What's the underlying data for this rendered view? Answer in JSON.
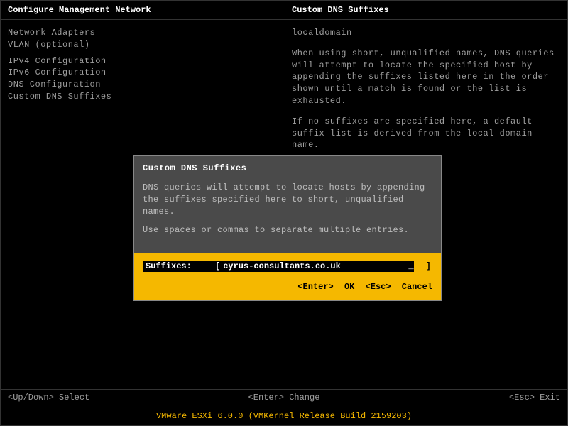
{
  "header": {
    "left": "Configure Management Network",
    "right": "Custom DNS Suffixes"
  },
  "menu": {
    "items": [
      "Network Adapters",
      "VLAN (optional)",
      "",
      "IPv4 Configuration",
      "IPv6 Configuration",
      "DNS Configuration",
      "Custom DNS Suffixes"
    ]
  },
  "info": {
    "domain": "localdomain",
    "p1": "When using short, unqualified names, DNS queries will attempt to locate the specified host by appending the suffixes listed here in the order shown until a match is found or the list is exhausted.",
    "p2": "If no suffixes are specified here, a default suffix list is derived from the local domain name."
  },
  "dialog": {
    "title": "Custom DNS Suffixes",
    "body1": "DNS queries will attempt to locate hosts by appending the suffixes specified here to short, unqualified names.",
    "body2": "Use spaces or commas to separate multiple entries.",
    "label": "Suffixes:",
    "bracket_l": "[",
    "value": "cyrus-consultants.co.uk",
    "cursor": "_",
    "bracket_r": "]",
    "ok_key": "<Enter>",
    "ok_label": "OK",
    "cancel_key": "<Esc>",
    "cancel_label": "Cancel"
  },
  "footer": {
    "left": "<Up/Down> Select",
    "center": "<Enter> Change",
    "right": "<Esc> Exit"
  },
  "status": "VMware ESXi 6.0.0 (VMKernel Release Build 2159203)"
}
